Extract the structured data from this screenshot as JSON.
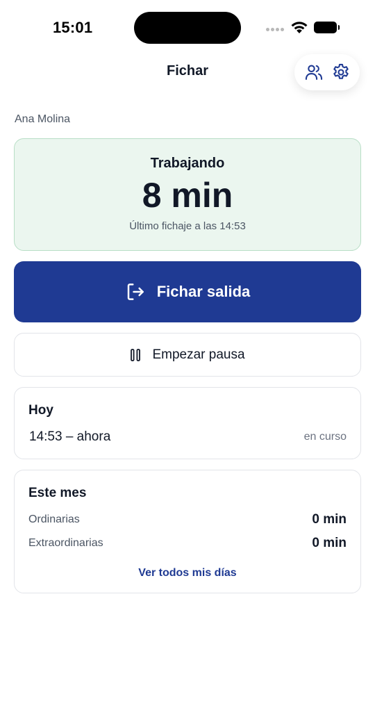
{
  "status_bar": {
    "time": "15:01"
  },
  "header": {
    "title": "Fichar",
    "team_icon": "users-icon",
    "settings_icon": "gear-icon"
  },
  "user": {
    "name": "Ana Molina"
  },
  "status": {
    "label": "Trabajando",
    "duration": "8 min",
    "last_punch": "Último fichaje a las 14:53"
  },
  "actions": {
    "primary_label": "Fichar salida",
    "primary_icon": "sign-out-icon",
    "secondary_label": "Empezar pausa",
    "secondary_icon": "pause-icon"
  },
  "today": {
    "title": "Hoy",
    "range": "14:53 – ahora",
    "state": "en curso"
  },
  "month": {
    "title": "Este mes",
    "rows": [
      {
        "label": "Ordinarias",
        "value": "0 min"
      },
      {
        "label": "Extraordinarias",
        "value": "0 min"
      }
    ],
    "link": "Ver todos mis días"
  },
  "colors": {
    "primary": "#1f3a93",
    "status_bg": "#ebf6ef",
    "status_border": "#b8dec6"
  }
}
